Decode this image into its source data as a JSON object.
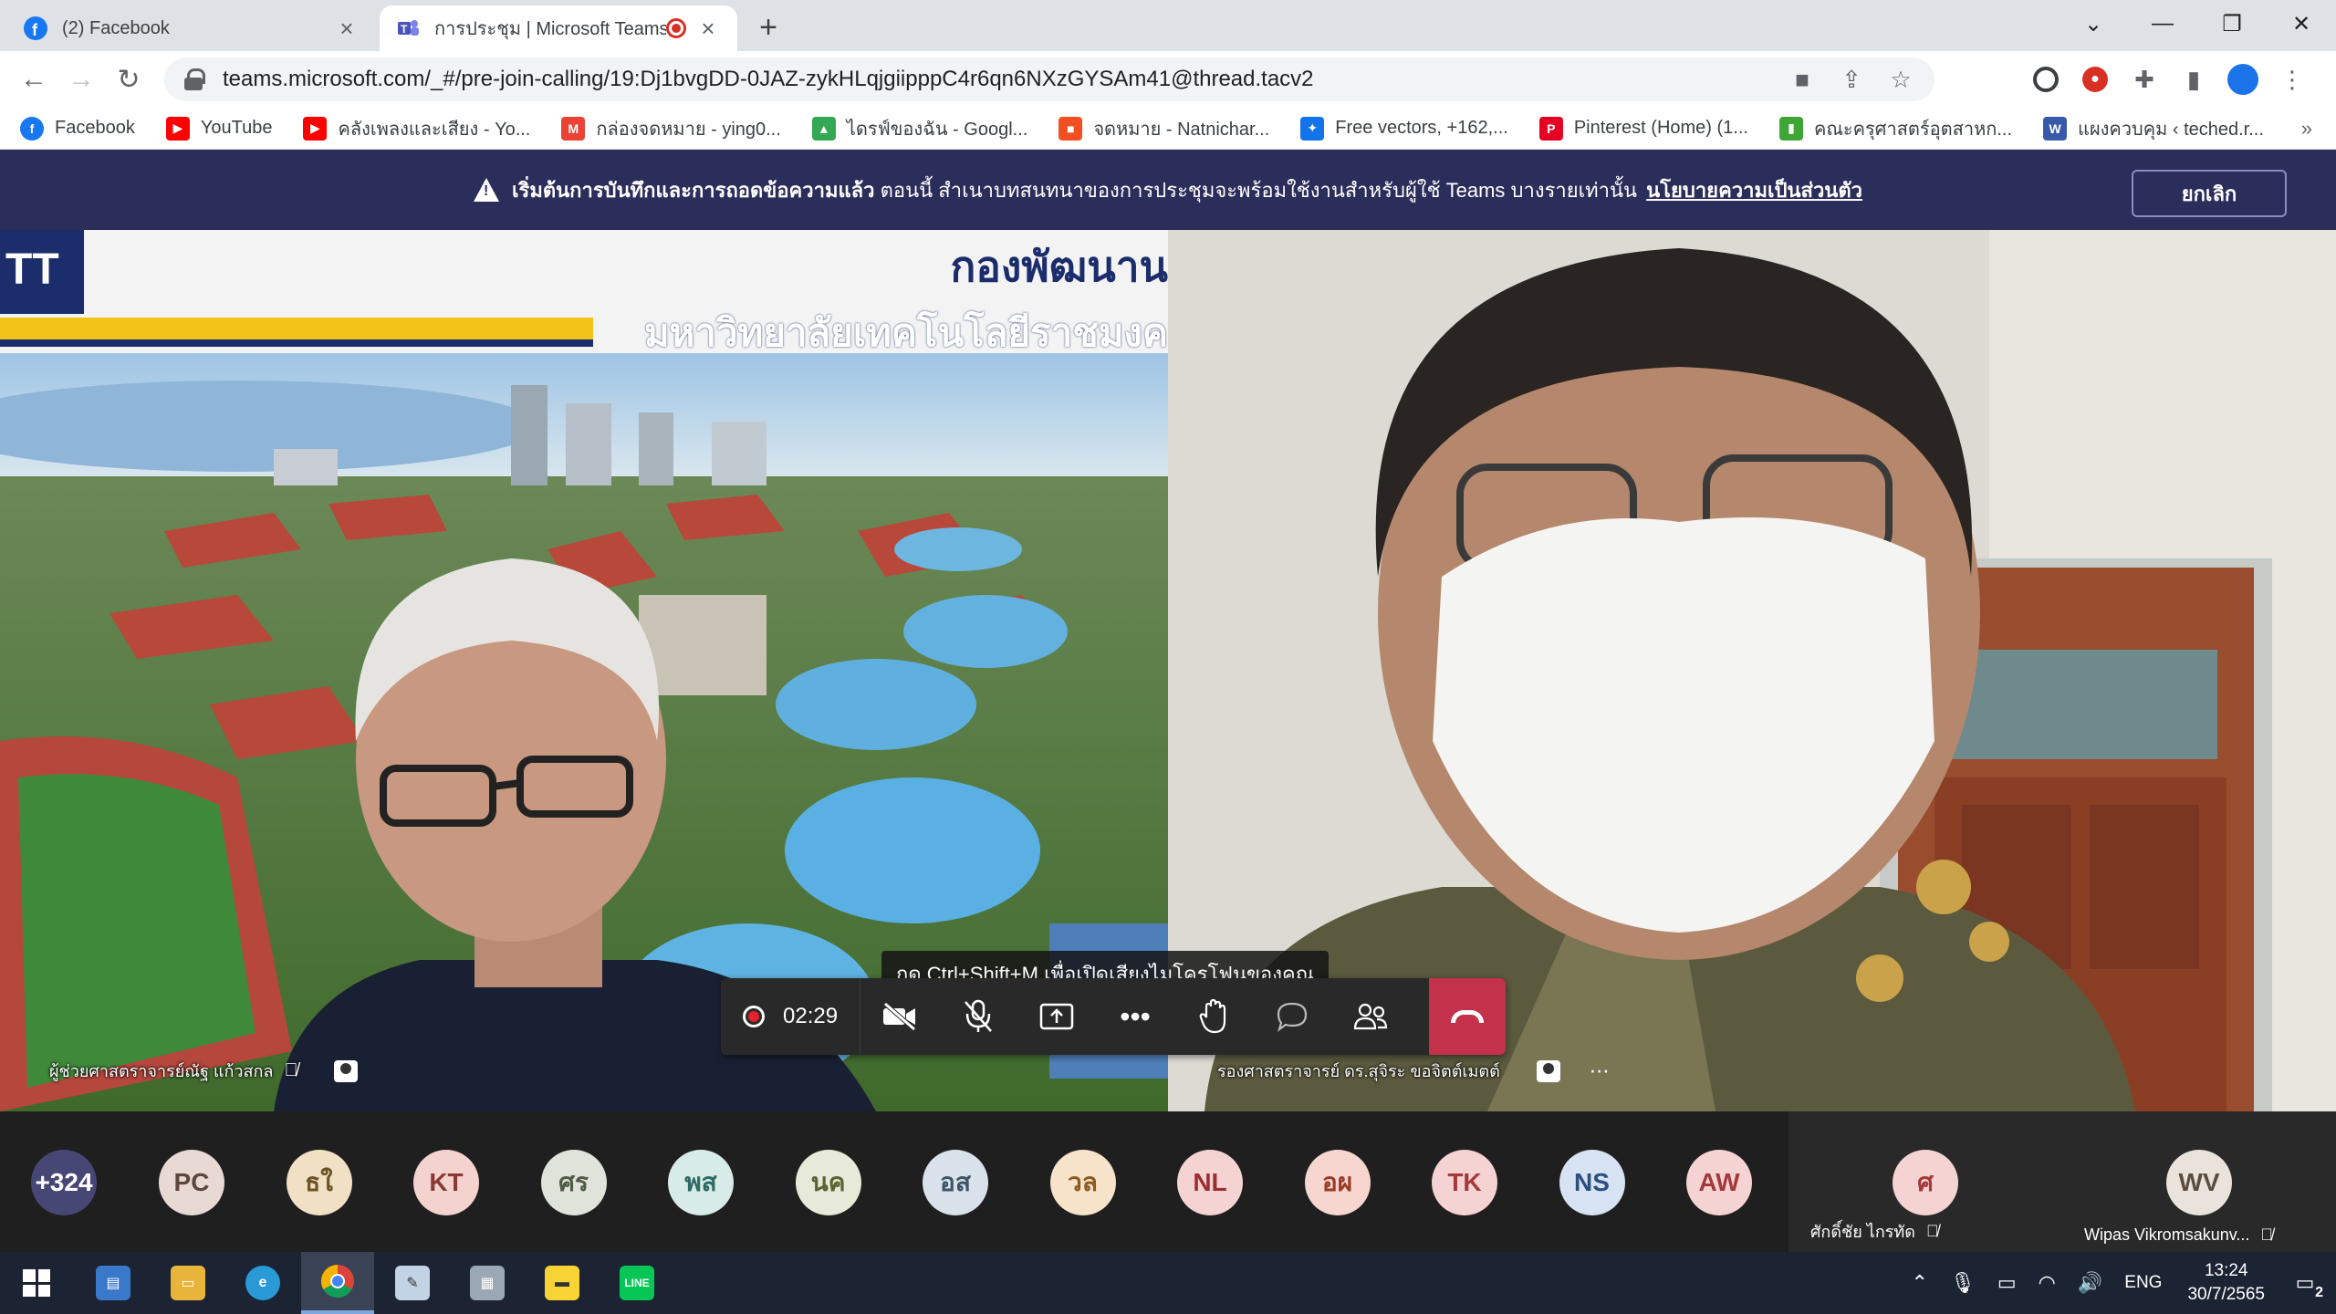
{
  "browser": {
    "tabs": [
      {
        "title": "(2) Facebook",
        "icon": "facebook-icon"
      },
      {
        "title": "การประชุม | Microsoft Teams",
        "icon": "teams-icon",
        "recording": true
      }
    ],
    "url": "teams.microsoft.com/_#/pre-join-calling/19:Dj1bvgDD-0JAZ-zykHLqjgiipppC4r6qn6NXzGYSAm41@thread.tacv2",
    "bookmarks": [
      {
        "label": "Facebook",
        "icon": "facebook-icon",
        "color": "#1877f2"
      },
      {
        "label": "YouTube",
        "icon": "youtube-icon",
        "color": "#ff0000"
      },
      {
        "label": "คลังเพลงและเสียง - Yo...",
        "icon": "youtube-icon",
        "color": "#ff0000"
      },
      {
        "label": "กล่องจดหมาย - ying0...",
        "icon": "gmail-icon",
        "color": "#ea4335"
      },
      {
        "label": "ไดรฟ์ของฉัน - Googl...",
        "icon": "google-drive-icon",
        "color": "#34a853"
      },
      {
        "label": "จดหมาย - Natnichar...",
        "icon": "microsoft-icon",
        "color": "#f25022"
      },
      {
        "label": "Free vectors, +162,...",
        "icon": "freepik-icon",
        "color": "#1273eb"
      },
      {
        "label": "Pinterest (Home) (1...",
        "icon": "pinterest-icon",
        "color": "#e60023"
      },
      {
        "label": "คณะครุศาสตร์อุตสาหก...",
        "icon": "book-icon",
        "color": "#3fa535"
      },
      {
        "label": "แผงควบคุม ‹ teched.r...",
        "icon": "wordpress-icon",
        "color": "#3858a8"
      }
    ]
  },
  "banner": {
    "bold_text": "เริ่มต้นการบันทึกและการถอดข้อความแล้ว",
    "text": " ตอนนี้ สำเนาบทสนทนาของการประชุมจะพร้อมใช้งานสำหรับผู้ใช้ Teams บางรายเท่านั้น",
    "link": "นโยบายความเป็นส่วนตัว",
    "cancel_label": "ยกเลิก"
  },
  "meeting": {
    "left_tile": {
      "name": "ผู้ช่วยศาสตราจารย์ณัฐ แก้วสกล",
      "slide_title_1": "กองพัฒนาน",
      "slide_title_2": "มหาวิทยาลัยเทคโนโลยีราชมงค",
      "logo_text": "TT"
    },
    "right_tile": {
      "name": "รองศาสตราจารย์ ดร.สุจิระ ขอจิตต์เมตต์"
    },
    "timer": "02:29",
    "tooltip": "กด Ctrl+Shift+M เพื่อเปิดเสียงไมโครโฟนของคุณ"
  },
  "participants": {
    "overflow": "+324",
    "avatars": [
      {
        "initials": "PC",
        "bg": "#e8d9d4",
        "fg": "#5b4640"
      },
      {
        "initials": "ธใ",
        "bg": "#f0e0c4",
        "fg": "#6b5326"
      },
      {
        "initials": "KT",
        "bg": "#f4d3cf",
        "fg": "#8a3a33"
      },
      {
        "initials": "ศร",
        "bg": "#dfe3da",
        "fg": "#4f5a47"
      },
      {
        "initials": "พส",
        "bg": "#d7ece9",
        "fg": "#2f6b63"
      },
      {
        "initials": "นค",
        "bg": "#e7ead8",
        "fg": "#5b6234"
      },
      {
        "initials": "อส",
        "bg": "#d9e2ea",
        "fg": "#3e5568"
      },
      {
        "initials": "วล",
        "bg": "#f7e3c9",
        "fg": "#8a5a1f"
      },
      {
        "initials": "NL",
        "bg": "#f6d3d3",
        "fg": "#9b2f2f"
      },
      {
        "initials": "อผ",
        "bg": "#f6d6cf",
        "fg": "#9a3b26"
      },
      {
        "initials": "TK",
        "bg": "#f6d3d3",
        "fg": "#a33a3a"
      },
      {
        "initials": "NS",
        "bg": "#d7e3f2",
        "fg": "#2c4f80"
      },
      {
        "initials": "AW",
        "bg": "#f6d3d3",
        "fg": "#a33a3a"
      }
    ],
    "named": [
      {
        "initials": "ศ",
        "name": "ศักดิ์ชัย ไกรทัด",
        "bg": "#f6d3d3",
        "fg": "#a33a3a"
      },
      {
        "initials": "WV",
        "name": "Wipas Vikromsakunv...",
        "bg": "#e9e3dc",
        "fg": "#5a4d40"
      }
    ]
  },
  "taskbar": {
    "lang": "ENG",
    "time": "13:24",
    "date": "30/7/2565",
    "notifications": "2"
  }
}
